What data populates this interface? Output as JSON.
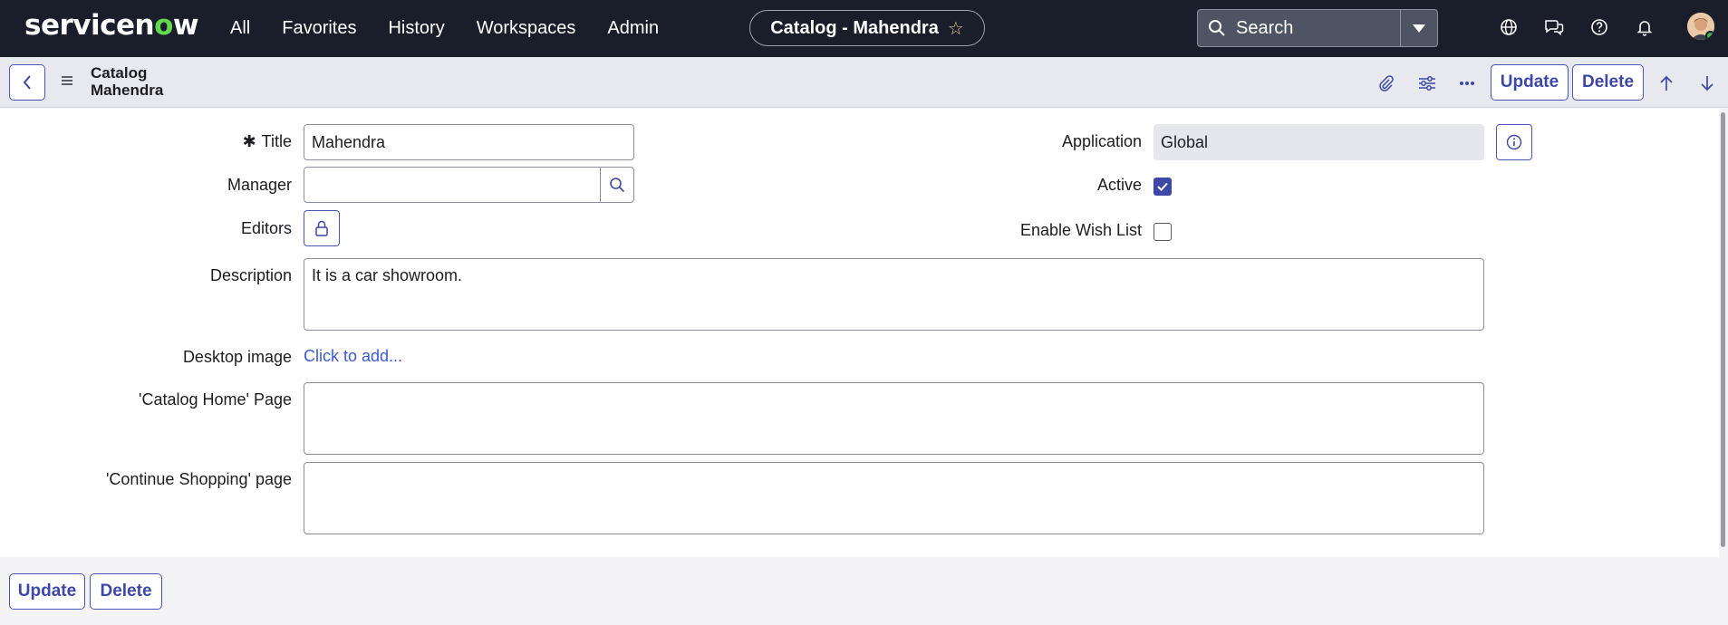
{
  "brand": {
    "logo_pre": "servicen",
    "logo_o": "o",
    "logo_post": "w"
  },
  "topnav": {
    "links": [
      "All",
      "Favorites",
      "History",
      "Workspaces",
      "Admin"
    ],
    "context_title": "Catalog - Mahendra",
    "search_placeholder": "Search",
    "icons": [
      "globe-icon",
      "chat-icon",
      "help-icon",
      "bell-icon"
    ]
  },
  "header": {
    "record_type": "Catalog",
    "record_name": "Mahendra",
    "update_label": "Update",
    "delete_label": "Delete"
  },
  "form": {
    "title": {
      "label": "Title",
      "value": "Mahendra",
      "required": true
    },
    "manager": {
      "label": "Manager",
      "value": ""
    },
    "editors": {
      "label": "Editors"
    },
    "application": {
      "label": "Application",
      "value": "Global"
    },
    "active": {
      "label": "Active",
      "checked": true
    },
    "wish_list": {
      "label": "Enable Wish List",
      "checked": false
    },
    "description": {
      "label": "Description",
      "value": "It is a car showroom."
    },
    "desktop_image": {
      "label": "Desktop image",
      "link": "Click to add..."
    },
    "catalog_home": {
      "label": "'Catalog Home' Page",
      "value": ""
    },
    "continue_shopping": {
      "label": "'Continue Shopping' page",
      "value": ""
    }
  },
  "footer": {
    "update_label": "Update",
    "delete_label": "Delete"
  },
  "colors": {
    "nav_bg": "#1a1d2a",
    "accent": "#3d47a8",
    "logo_green": "#62d84e"
  }
}
